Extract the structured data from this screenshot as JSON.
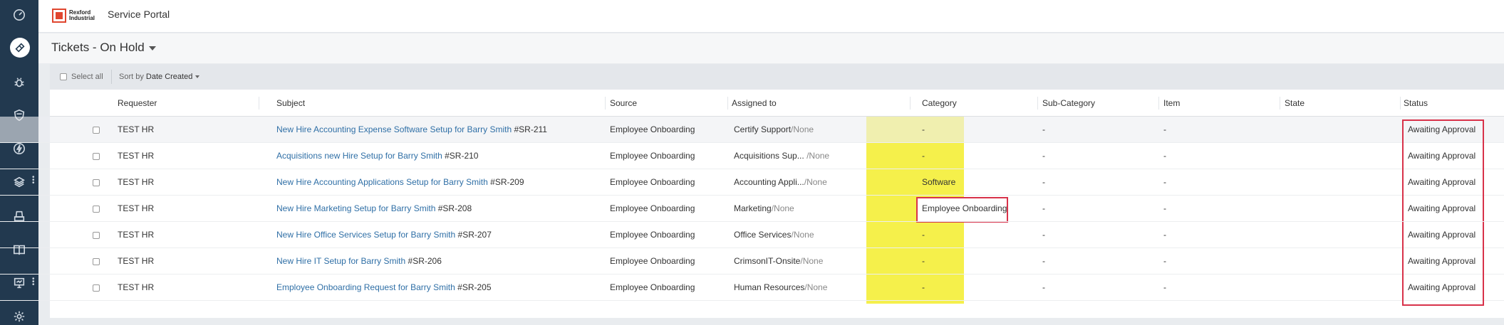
{
  "app": {
    "logo_text_1": "Rexford",
    "logo_text_2": "Industrial",
    "portal_title": "Service Portal"
  },
  "page": {
    "title": "Tickets - On Hold"
  },
  "toolbar": {
    "select_all": "Select all",
    "sort_prefix": "Sort by ",
    "sort_value": "Date Created"
  },
  "columns": [
    "Requester",
    "Subject",
    "Source",
    "Assigned to",
    "Category",
    "Sub-Category",
    "Item",
    "State",
    "Status"
  ],
  "rows": [
    {
      "requester": "TEST HR",
      "subject": "New Hire Accounting Expense Software Setup for Barry Smith",
      "ref": "#SR-211",
      "source": "Employee Onboarding",
      "assigned": "Certify Support",
      "assigned_none": "/None",
      "category": "-",
      "subcategory": "-",
      "item": "-",
      "state": "",
      "status": "Awaiting Approval"
    },
    {
      "requester": "TEST HR",
      "subject": "Acquisitions new Hire Setup for Barry Smith",
      "ref": "#SR-210",
      "source": "Employee Onboarding",
      "assigned": "Acquisitions Sup...",
      "assigned_none": "/None",
      "category": "-",
      "subcategory": "-",
      "item": "-",
      "state": "",
      "status": "Awaiting Approval"
    },
    {
      "requester": "TEST HR",
      "subject": "New Hire Accounting Applications Setup for Barry Smith",
      "ref": "#SR-209",
      "source": "Employee Onboarding",
      "assigned": "Accounting Appli...",
      "assigned_none": "/None",
      "category": "Software",
      "subcategory": "-",
      "item": "-",
      "state": "",
      "status": "Awaiting Approval"
    },
    {
      "requester": "TEST HR",
      "subject": "New Hire Marketing Setup for Barry Smith",
      "ref": "#SR-208",
      "source": "Employee Onboarding",
      "assigned": "Marketing",
      "assigned_none": "/None",
      "category": "Employee Onboarding",
      "subcategory": "-",
      "item": "-",
      "state": "",
      "status": "Awaiting Approval"
    },
    {
      "requester": "TEST HR",
      "subject": "New Hire Office Services Setup for Barry Smith",
      "ref": "#SR-207",
      "source": "Employee Onboarding",
      "assigned": "Office Services",
      "assigned_none": "/None",
      "category": "-",
      "subcategory": "-",
      "item": "-",
      "state": "",
      "status": "Awaiting Approval"
    },
    {
      "requester": "TEST HR",
      "subject": "New Hire IT Setup for Barry Smith",
      "ref": "#SR-206",
      "source": "Employee Onboarding",
      "assigned": "CrimsonIT-Onsite",
      "assigned_none": "/None",
      "category": "-",
      "subcategory": "-",
      "item": "-",
      "state": "",
      "status": "Awaiting Approval"
    },
    {
      "requester": "TEST HR",
      "subject": "Employee Onboarding Request for Barry Smith",
      "ref": "#SR-205",
      "source": "Employee Onboarding",
      "assigned": "Human Resources",
      "assigned_none": "/None",
      "category": "-",
      "subcategory": "-",
      "item": "-",
      "state": "",
      "status": "Awaiting Approval"
    }
  ],
  "colors": {
    "sidebar": "#22394f",
    "link": "#2f6fa6",
    "highlight": "#f5f04b",
    "annotation": "#d8324a"
  },
  "sidebar_icons": [
    "dashboard-icon",
    "ticket-icon",
    "bug-icon",
    "shield-icon",
    "lightning-icon",
    "layers-icon",
    "inbox-tray-icon",
    "book-icon",
    "presentation-icon",
    "gear-icon"
  ]
}
